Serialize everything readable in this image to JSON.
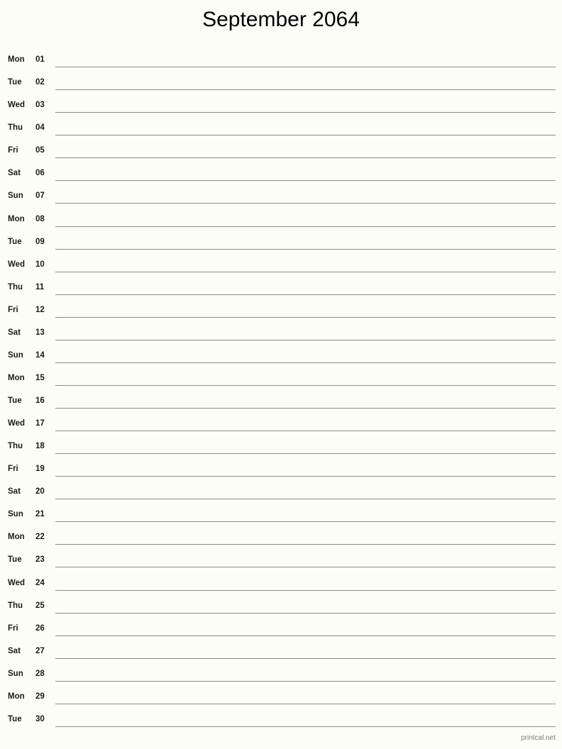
{
  "page": {
    "title": "September 2064",
    "month": "September",
    "year": "2064",
    "background_color": "#fdfdf8",
    "line_color": "#8a8a8a",
    "text_color": "#1a1a1a"
  },
  "footer": {
    "credit": "printcal.net",
    "color": "#7a7a7a"
  },
  "days": [
    {
      "weekday": "Mon",
      "number": "01"
    },
    {
      "weekday": "Tue",
      "number": "02"
    },
    {
      "weekday": "Wed",
      "number": "03"
    },
    {
      "weekday": "Thu",
      "number": "04"
    },
    {
      "weekday": "Fri",
      "number": "05"
    },
    {
      "weekday": "Sat",
      "number": "06"
    },
    {
      "weekday": "Sun",
      "number": "07"
    },
    {
      "weekday": "Mon",
      "number": "08"
    },
    {
      "weekday": "Tue",
      "number": "09"
    },
    {
      "weekday": "Wed",
      "number": "10"
    },
    {
      "weekday": "Thu",
      "number": "11"
    },
    {
      "weekday": "Fri",
      "number": "12"
    },
    {
      "weekday": "Sat",
      "number": "13"
    },
    {
      "weekday": "Sun",
      "number": "14"
    },
    {
      "weekday": "Mon",
      "number": "15"
    },
    {
      "weekday": "Tue",
      "number": "16"
    },
    {
      "weekday": "Wed",
      "number": "17"
    },
    {
      "weekday": "Thu",
      "number": "18"
    },
    {
      "weekday": "Fri",
      "number": "19"
    },
    {
      "weekday": "Sat",
      "number": "20"
    },
    {
      "weekday": "Sun",
      "number": "21"
    },
    {
      "weekday": "Mon",
      "number": "22"
    },
    {
      "weekday": "Tue",
      "number": "23"
    },
    {
      "weekday": "Wed",
      "number": "24"
    },
    {
      "weekday": "Thu",
      "number": "25"
    },
    {
      "weekday": "Fri",
      "number": "26"
    },
    {
      "weekday": "Sat",
      "number": "27"
    },
    {
      "weekday": "Sun",
      "number": "28"
    },
    {
      "weekday": "Mon",
      "number": "29"
    },
    {
      "weekday": "Tue",
      "number": "30"
    }
  ]
}
